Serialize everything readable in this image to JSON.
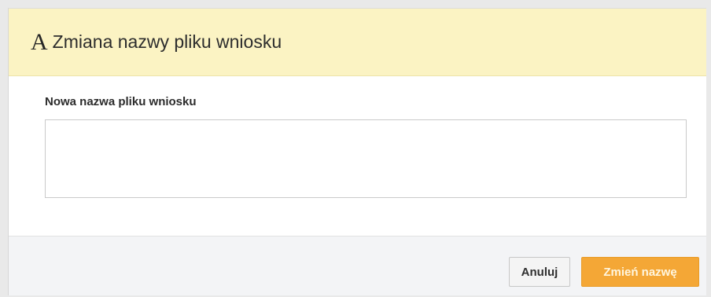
{
  "dialog": {
    "title_icon": "A",
    "title": "Zmiana nazwy pliku wniosku",
    "field_label": "Nowa nazwa pliku wniosku",
    "field_value": "",
    "cancel_label": "Anuluj",
    "confirm_label": "Zmień nazwę"
  },
  "colors": {
    "header_bg": "#fbf3c3",
    "primary_button": "#f4a736",
    "footer_bg": "#f3f4f6"
  }
}
